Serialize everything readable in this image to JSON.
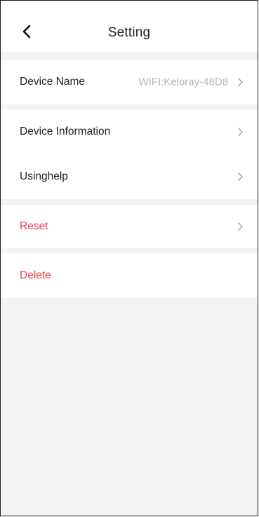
{
  "header": {
    "title": "Setting",
    "back_icon": "chevron-left-icon"
  },
  "device_name": {
    "label": "Device Name",
    "value": "WIFI:Keloray-48D8"
  },
  "device_information": {
    "label": "Device Information"
  },
  "using_help": {
    "label": "Usinghelp"
  },
  "reset": {
    "label": "Reset"
  },
  "delete": {
    "label": "Delete"
  },
  "colors": {
    "destructive": "#e8474c",
    "page_background": "#f3f3f3",
    "row_background": "#ffffff",
    "secondary_text": "#b5b5b5",
    "chevron": "#9a9a9a"
  }
}
